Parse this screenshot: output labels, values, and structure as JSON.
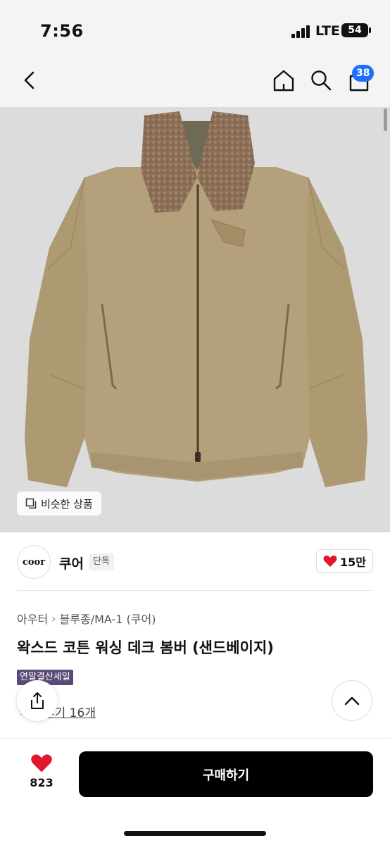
{
  "status_bar": {
    "time": "7:56",
    "network": "LTE",
    "battery": "54"
  },
  "header": {
    "cart_count": "38"
  },
  "hero": {
    "similar_label": "비슷한 상품"
  },
  "brand": {
    "logo_text": "coor",
    "name": "쿠어",
    "exclusive_tag": "단독",
    "like_count": "15만"
  },
  "breadcrumb": {
    "category": "아우터",
    "subcategory": "블루종/MA-1 (쿠어)"
  },
  "product": {
    "title": "왁스드 코튼 워싱 데크 봄버 (샌드베이지)",
    "sale_tag": "연말결산세일",
    "review_link": "후기 16개"
  },
  "bottom": {
    "likes": "823",
    "buy_label": "구매하기"
  },
  "colors": {
    "accent_badge": "#1e6fff",
    "heart": "#e0182d",
    "sale_tag": "#5a4a78",
    "buy_button": "#000000",
    "jacket": "#b4a07a",
    "collar": "#8c6f58"
  }
}
